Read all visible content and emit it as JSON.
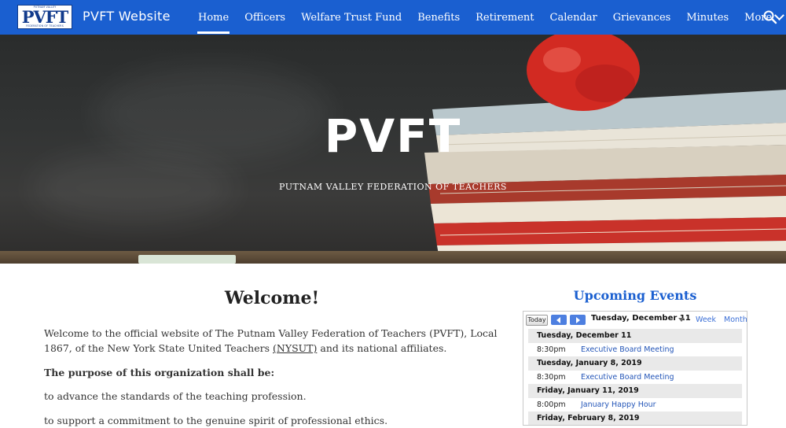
{
  "site": {
    "logo_small": "PUTNAM VALLEY",
    "logo_text": "PVFT",
    "logo_small_bottom": "FEDERATION OF TEACHERS",
    "title": "PVFT Website"
  },
  "nav": {
    "items": [
      {
        "label": "Home",
        "active": true
      },
      {
        "label": "Officers"
      },
      {
        "label": "Welfare Trust Fund"
      },
      {
        "label": "Benefits"
      },
      {
        "label": "Retirement"
      },
      {
        "label": "Calendar"
      },
      {
        "label": "Grievances"
      },
      {
        "label": "Minutes"
      },
      {
        "label": "More"
      }
    ],
    "search_icon": "search-icon"
  },
  "hero": {
    "title": "PVFT",
    "subtitle": "PUTNAM VALLEY FEDERATION OF TEACHERS"
  },
  "main": {
    "heading": "Welcome!",
    "intro_before": "Welcome to the official website of The Putnam Valley Federation of Teachers (PVFT), Local 1867, of the New York State United Teachers ",
    "intro_link": "(NYSUT)",
    "intro_after": " and its national affiliates.",
    "purpose": "The purpose of this organization shall be:",
    "point1": "to advance the standards of the teaching profession.",
    "point2": "to support a commitment to the genuine spirit of professional ethics."
  },
  "events": {
    "title": "Upcoming Events",
    "today_label": "Today",
    "current_date": "Tuesday, December 11",
    "week_label": "Week",
    "month_label": "Month",
    "days": [
      {
        "date": "Tuesday, December 11",
        "events": [
          {
            "time": "8:30pm",
            "name": "Executive Board Meeting"
          }
        ]
      },
      {
        "date": "Tuesday, January 8, 2019",
        "events": [
          {
            "time": "8:30pm",
            "name": "Executive Board Meeting"
          }
        ]
      },
      {
        "date": "Friday, January 11, 2019",
        "events": [
          {
            "time": "8:00pm",
            "name": "January Happy Hour"
          }
        ]
      },
      {
        "date": "Friday, February 8, 2019",
        "events": []
      }
    ]
  },
  "colors": {
    "brand_blue": "#1a5fd0",
    "link_blue": "#2456b8"
  }
}
